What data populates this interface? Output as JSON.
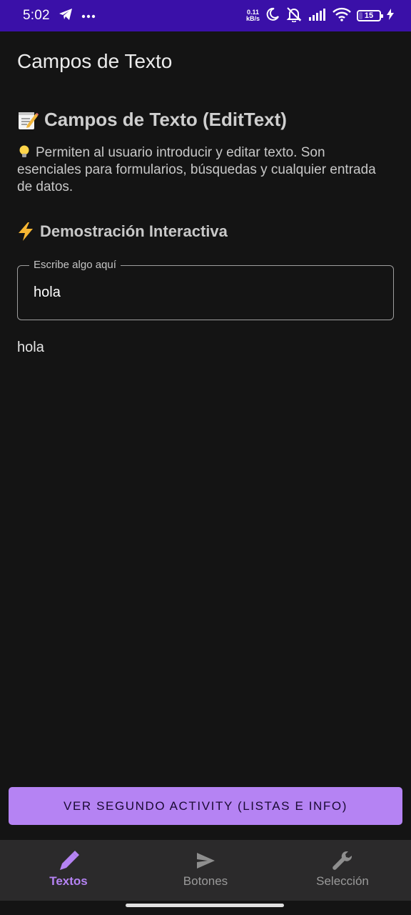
{
  "status_bar": {
    "time": "5:02",
    "net_speed_value": "0.11",
    "net_speed_unit": "kB/s",
    "battery_level": "15",
    "battery_fraction": 0.15,
    "icons": [
      "telegram-icon",
      "more-dots-icon",
      "moon-icon",
      "mute-icon",
      "signal-icon",
      "wifi-icon",
      "battery-icon",
      "charging-icon"
    ]
  },
  "app_bar": {
    "title": "Campos de Texto"
  },
  "section": {
    "title": "Campos de Texto (EditText)",
    "description": "Permiten al usuario introducir y editar texto. Son esenciales para formularios, búsquedas y cualquier entrada de datos."
  },
  "demo": {
    "title": "Demostración Interactiva",
    "field_label": "Escribe algo aquí",
    "field_value": "hola",
    "echo_text": "hola"
  },
  "primary_button": {
    "label": "VER SEGUNDO ACTIVITY (LISTAS E INFO)"
  },
  "bottom_nav": {
    "items": [
      {
        "label": "Textos",
        "icon": "pencil-icon",
        "active": true
      },
      {
        "label": "Botones",
        "icon": "send-icon",
        "active": false
      },
      {
        "label": "Selección",
        "icon": "wrench-icon",
        "active": false
      }
    ]
  },
  "colors": {
    "status_bar": "#3a10a8",
    "background": "#141414",
    "accent": "#b583f3",
    "nav_background": "#2b2a2b"
  }
}
